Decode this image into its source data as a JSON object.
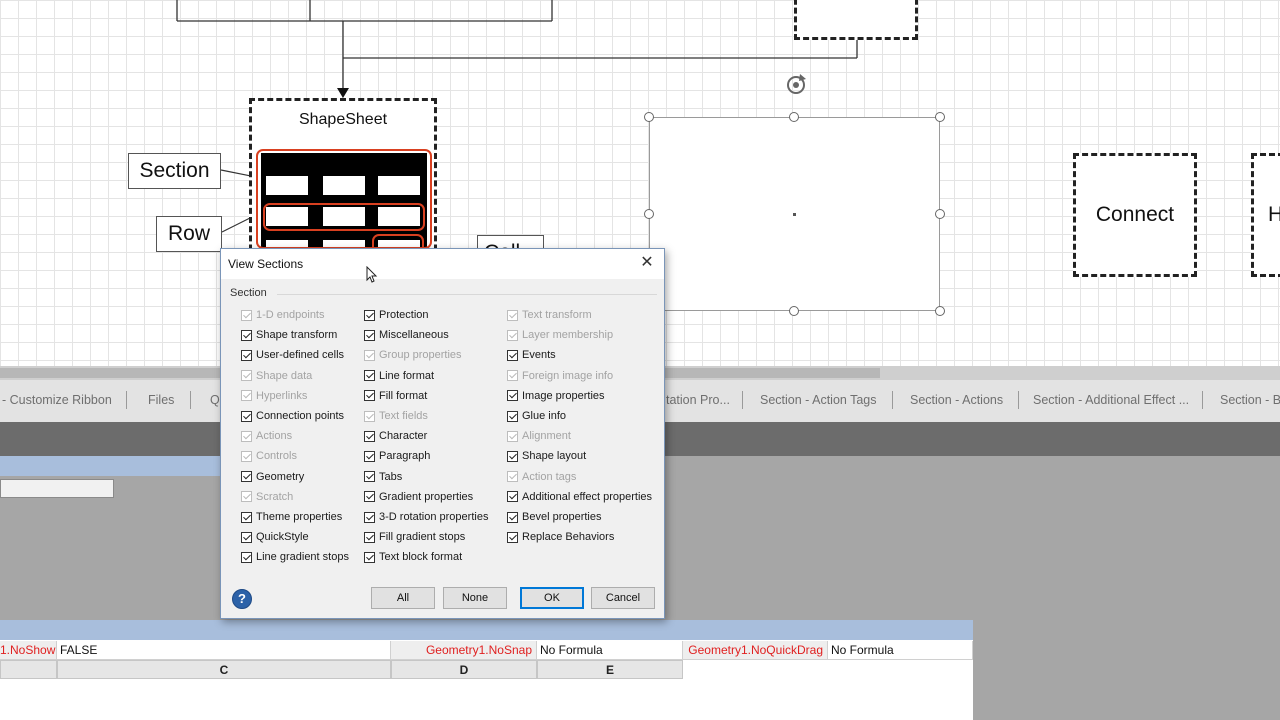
{
  "canvas": {
    "shapesheet_title": "ShapeSheet",
    "callout_section": "Section",
    "callout_row": "Row",
    "callout_cell_partial": "Cell",
    "connect_label": "Connect",
    "partial_right_label": "H"
  },
  "tabs": [
    "- Customize Ribbon",
    "Files",
    "Q",
    "tation Pro...",
    "Section - Action Tags",
    "Section - Actions",
    "Section - Additional Effect ...",
    "Section - B"
  ],
  "dialog": {
    "title": "View Sections",
    "close_glyph": "✕",
    "group_label": "Section",
    "columns": [
      [
        {
          "label": "1-D endpoints",
          "checked": true,
          "enabled": false
        },
        {
          "label": "Shape transform",
          "checked": true,
          "enabled": true
        },
        {
          "label": "User-defined cells",
          "checked": true,
          "enabled": true
        },
        {
          "label": "Shape data",
          "checked": true,
          "enabled": false
        },
        {
          "label": "Hyperlinks",
          "checked": true,
          "enabled": false
        },
        {
          "label": "Connection points",
          "checked": true,
          "enabled": true
        },
        {
          "label": "Actions",
          "checked": true,
          "enabled": false
        },
        {
          "label": "Controls",
          "checked": true,
          "enabled": false
        },
        {
          "label": "Geometry",
          "checked": true,
          "enabled": true
        },
        {
          "label": "Scratch",
          "checked": true,
          "enabled": false
        },
        {
          "label": "Theme properties",
          "checked": true,
          "enabled": true
        },
        {
          "label": "QuickStyle",
          "checked": true,
          "enabled": true
        },
        {
          "label": "Line gradient stops",
          "checked": true,
          "enabled": true
        }
      ],
      [
        {
          "label": "Protection",
          "checked": true,
          "enabled": true
        },
        {
          "label": "Miscellaneous",
          "checked": true,
          "enabled": true
        },
        {
          "label": "Group properties",
          "checked": true,
          "enabled": false
        },
        {
          "label": "Line format",
          "checked": true,
          "enabled": true
        },
        {
          "label": "Fill format",
          "checked": true,
          "enabled": true
        },
        {
          "label": "Text fields",
          "checked": true,
          "enabled": false
        },
        {
          "label": "Character",
          "checked": true,
          "enabled": true
        },
        {
          "label": "Paragraph",
          "checked": true,
          "enabled": true
        },
        {
          "label": "Tabs",
          "checked": true,
          "enabled": true
        },
        {
          "label": "Gradient properties",
          "checked": true,
          "enabled": true
        },
        {
          "label": "3-D rotation properties",
          "checked": true,
          "enabled": true
        },
        {
          "label": "Fill gradient stops",
          "checked": true,
          "enabled": true
        },
        {
          "label": "Text block format",
          "checked": true,
          "enabled": true
        }
      ],
      [
        {
          "label": "Text transform",
          "checked": true,
          "enabled": false
        },
        {
          "label": "Layer membership",
          "checked": true,
          "enabled": false
        },
        {
          "label": "Events",
          "checked": true,
          "enabled": true
        },
        {
          "label": "Foreign image info",
          "checked": true,
          "enabled": false
        },
        {
          "label": "Image properties",
          "checked": true,
          "enabled": true
        },
        {
          "label": "Glue info",
          "checked": true,
          "enabled": true
        },
        {
          "label": "Alignment",
          "checked": true,
          "enabled": false
        },
        {
          "label": "Shape layout",
          "checked": true,
          "enabled": true
        },
        {
          "label": "Action tags",
          "checked": true,
          "enabled": false
        },
        {
          "label": "Additional effect properties",
          "checked": true,
          "enabled": true
        },
        {
          "label": "Bevel properties",
          "checked": true,
          "enabled": true
        },
        {
          "label": "Replace Behaviors",
          "checked": true,
          "enabled": true
        }
      ]
    ],
    "buttons": {
      "all": "All",
      "none": "None",
      "ok": "OK",
      "cancel": "Cancel"
    },
    "help_glyph": "?"
  },
  "sheet": {
    "row": [
      {
        "label": "1.NoShow",
        "value": "FALSE"
      },
      {
        "label": "Geometry1.NoSnap",
        "value": "No Formula"
      },
      {
        "label": "Geometry1.NoQuickDrag",
        "value": "No Formula"
      }
    ],
    "col_headers": [
      "C",
      "D",
      "E"
    ]
  },
  "colors": {
    "formula_label": "#e02020",
    "selection_accent": "#d94020",
    "sheet_header_blue": "#a8bedc"
  }
}
